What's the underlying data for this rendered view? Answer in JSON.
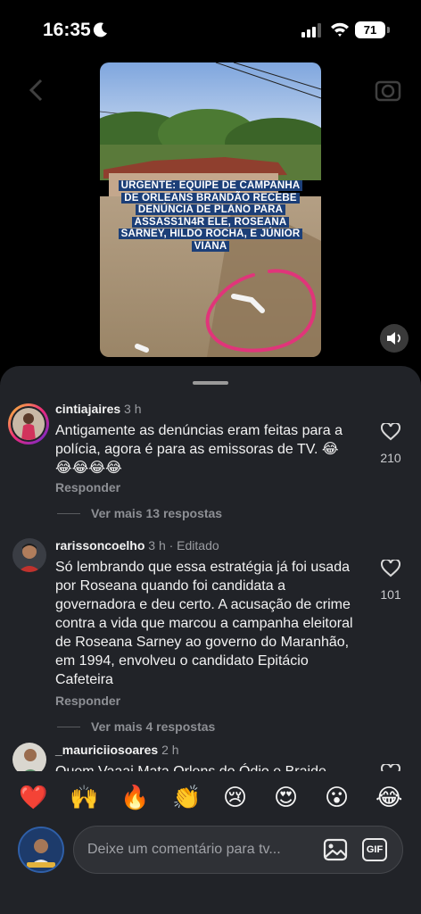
{
  "status_bar": {
    "time": "16:35",
    "battery": "71"
  },
  "video": {
    "caption": "URGENTE: EQUIPE DE CAMPANHA DE ORLEANS BRANDÃO RECEBE DENÚNCIA DE PLANO PARA ASSASS1N4R ELE, ROSEANA SARNEY, HILDO ROCHA, E JÚNIOR VIANA"
  },
  "comments": [
    {
      "username": "cintiajaires",
      "time": "3 h",
      "edited": "",
      "text": "Antigamente as denúncias eram feitas para a polícia, agora é para as emissoras de TV. 😂😂😂😂😂",
      "likes": "210",
      "reply_label": "Responder",
      "more_replies": "Ver mais 13 respostas"
    },
    {
      "username": "rarissoncoelho",
      "time": "3 h",
      "edited": "· Editado",
      "text": "Só lembrando que essa estratégia já foi usada por Roseana quando foi candidata a governadora e deu certo. A acusação de crime contra a vida que marcou a campanha eleitoral de Roseana Sarney ao governo do Maranhão, em 1994, envolveu o candidato Epitácio Cafeteira",
      "likes": "101",
      "reply_label": "Responder",
      "more_replies": "Ver mais 4 respostas"
    },
    {
      "username": "_mauriciiosoares",
      "time": "2 h",
      "text": "Quem Vaaai Mata Orlens do Ódio e Braide"
    }
  ],
  "emoji_bar": [
    "❤️",
    "🙌",
    "🔥",
    "👏",
    "😢",
    "😍",
    "😮",
    "😂"
  ],
  "compose": {
    "placeholder": "Deixe um comentário para tv...",
    "gif_label": "GIF"
  },
  "colors": {
    "sheet": "#212328",
    "caption_bg": "#1c3f78",
    "circle_annotation": "#e0357a"
  },
  "icons": [
    "moon-icon",
    "signal-icon",
    "wifi-icon",
    "battery-icon",
    "back-icon",
    "camera-icon",
    "speaker-icon",
    "heart-icon",
    "image-icon",
    "gif-icon"
  ]
}
